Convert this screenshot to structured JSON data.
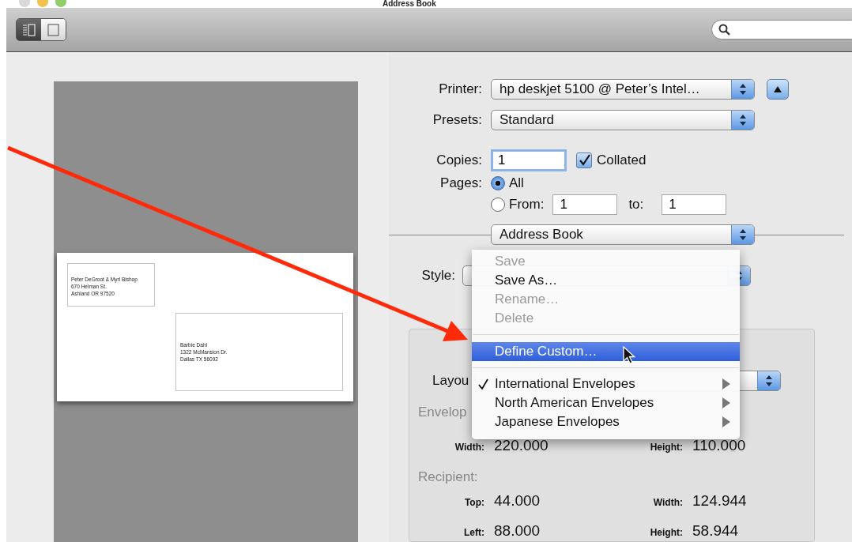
{
  "window": {
    "title": "Address Book"
  },
  "toolbar": {
    "view_buttons": [
      {
        "kind": "list",
        "selected": true
      },
      {
        "kind": "card",
        "selected": false
      }
    ]
  },
  "preview": {
    "return_address": [
      "Peter DeGroot & Myrl Bishop",
      "670 Helman St.",
      "Ashland OR 97520"
    ],
    "recipient_address": [
      "Barbie Dahl",
      "1322 McMansion Dr.",
      "Dallas TX 56092"
    ]
  },
  "print": {
    "printer": {
      "label": "Printer:",
      "value": "hp deskjet 5100 @ Peter’s Intel…"
    },
    "presets": {
      "label": "Presets:",
      "value": "Standard"
    },
    "copies": {
      "label": "Copies:",
      "value": "1"
    },
    "collated": {
      "label": "Collated",
      "checked": true
    },
    "pages": {
      "label": "Pages:",
      "options": [
        {
          "label": "All",
          "selected": true
        },
        {
          "label": "From:",
          "selected": false
        }
      ],
      "from": "1",
      "to_label": "to:",
      "to": "1"
    },
    "app_popup": {
      "value": "Address Book"
    },
    "style": {
      "label": "Style:"
    },
    "layout": {
      "label": "Layou"
    },
    "envelope": {
      "heading": "Envelop",
      "fields": [
        {
          "label": "Width:",
          "value": "220.000"
        },
        {
          "label": "Height:",
          "value": "110.000"
        }
      ]
    },
    "recipient": {
      "heading": "Recipient:",
      "fields": [
        {
          "label": "Top:",
          "value": "44.000"
        },
        {
          "label": "Width:",
          "value": "124.944"
        },
        {
          "label": "Left:",
          "value": "88.000"
        },
        {
          "label": "Height:",
          "value": "58.944"
        }
      ]
    }
  },
  "menu": {
    "items": [
      {
        "kind": "item",
        "label": "Save",
        "disabled": true,
        "selected": false,
        "checked": false,
        "submenu": false
      },
      {
        "kind": "item",
        "label": "Save As…",
        "disabled": false,
        "selected": false,
        "checked": false,
        "submenu": false
      },
      {
        "kind": "item",
        "label": "Rename…",
        "disabled": true,
        "selected": false,
        "checked": false,
        "submenu": false
      },
      {
        "kind": "item",
        "label": "Delete",
        "disabled": true,
        "selected": false,
        "checked": false,
        "submenu": false
      },
      {
        "kind": "separator"
      },
      {
        "kind": "item",
        "label": "Define Custom…",
        "disabled": false,
        "selected": true,
        "checked": false,
        "submenu": false
      },
      {
        "kind": "separator"
      },
      {
        "kind": "item",
        "label": "International Envelopes",
        "disabled": false,
        "selected": false,
        "checked": true,
        "submenu": true
      },
      {
        "kind": "item",
        "label": "North American Envelopes",
        "disabled": false,
        "selected": false,
        "checked": false,
        "submenu": true
      },
      {
        "kind": "item",
        "label": "Japanese Envelopes",
        "disabled": false,
        "selected": false,
        "checked": false,
        "submenu": true
      }
    ]
  }
}
